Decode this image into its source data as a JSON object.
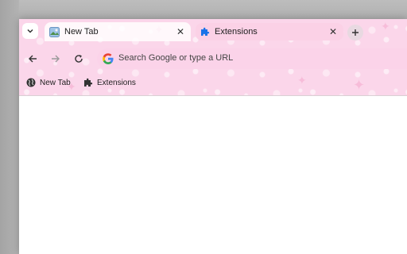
{
  "tabs": [
    {
      "label": "New Tab",
      "icon": "new-tab-page-icon",
      "active": true
    },
    {
      "label": "Extensions",
      "icon": "puzzle-piece-icon",
      "active": false
    }
  ],
  "close_symbol": "✕",
  "omnibox": {
    "placeholder": "Search Google or type a URL"
  },
  "bookmarks": [
    {
      "label": "New Tab",
      "icon": "globe-icon"
    },
    {
      "label": "Extensions",
      "icon": "puzzle-piece-icon"
    }
  ],
  "colors": {
    "frame": "#fbd6ea",
    "omnibox": "#fbd3e9",
    "extension_icon": "#1a73e8"
  }
}
